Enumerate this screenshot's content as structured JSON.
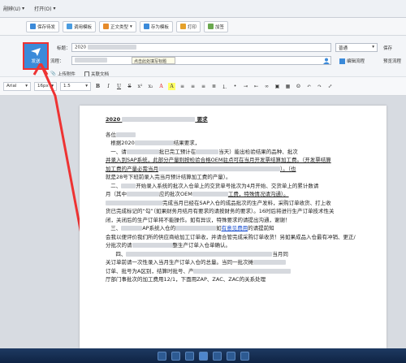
{
  "menubar": {
    "items": [
      "剐辨(U)",
      "打开(O)"
    ]
  },
  "toolbar": {
    "buttons": [
      {
        "label": "保存待发",
        "icon": "save-icon",
        "color": "#3b8ad9"
      },
      {
        "label": "调用模板",
        "icon": "template-icon",
        "color": "#4a9ce0"
      },
      {
        "label": "正文类型",
        "icon": "doc-type-icon",
        "color": "#e58a2a"
      },
      {
        "label": "存为模板",
        "icon": "save-template-icon",
        "color": "#3b8ad9"
      },
      {
        "label": "打印",
        "icon": "print-icon",
        "color": "#e5a12a"
      },
      {
        "label": "加签",
        "icon": "sign-icon",
        "color": "#6aa84f"
      }
    ]
  },
  "form": {
    "send_label": "发送",
    "title_label": "标题：",
    "title_value": "2020",
    "flow_label": "流程：",
    "tooltip": "点击此处填写标题",
    "priority": "普通",
    "save_label": "保存",
    "edit_flow": "编辑流程",
    "preview_flow": "预览流程",
    "attach_label": "上传附件",
    "related_doc": "关联文档"
  },
  "format": {
    "font": "Arial",
    "size": "16px",
    "line": "1.5"
  },
  "doc": {
    "title": "2020",
    "title_suffix": "要求",
    "l1": "各位",
    "l2a": "根据2020",
    "l2b": "结果要求，",
    "l3a": "一、请",
    "l3b": "批已完工预计在",
    "l3c": "当天）能出检验结果的品种、批次",
    "l4": "并录入到SAP系统，此部分产量则按检验合格OEM驻点可在当月开发票结算加工费。（开发票结算",
    "l5a": "加工费的产量必需当月",
    "l5b": "）。（也",
    "l6": "就是28号下班前录入完当月预计结算加工费的产量）。",
    "l7a": "二、",
    "l7b": "开始录入系统的批次入仓单上的交货单号批次为4月开始、交货单上的累计数请",
    "l8a": "月（其中",
    "l8b": "应的批次OEM",
    "l8c": "工费，特殊情况请沟通）。",
    "l9": "完成当月已经在SAP入仓的成品批次的生产发料，采购订单收货、打上收",
    "l10": "货已完成标记的“勾”（如果财务月结月有要求的请按财务的要求）。16时后将进行生产订单技术性关",
    "l11": "闭，关闭后的生产订单将不能操作。如有异议，特殊要求的请提出沟通，谢谢！",
    "l12a": "三、",
    "l12b": "AP系统入仓的",
    "l12c": "如",
    "l12d": "有意见费用",
    "l12e": "的请提前知",
    "l13": "会我以便评价我们所的供应商给加工订单收，并请合管完成采购订单收货！另如果成品入仓最有冲销、更正/",
    "l14a": "分批次的请",
    "l14b": "整生产订单入仓单确认。",
    "l15a": "四、",
    "l15b": "当月同",
    "l16": "关订单前请一次性录入当月生产订单入仓的总量。当同一批次摊",
    "l17a": "订单、批号为A区别，结算时批号、产",
    "l18": "厅部门事批次的加工费用12/1，下面用ZAP、ZAC、ZAC的关系处理"
  },
  "watermark": "软件技巧",
  "taskbar": {
    "icons": [
      "search-icon",
      "back-icon",
      "app-icon-1",
      "app-icon-2",
      "app-icon-3",
      "app-icon-4",
      "forward-icon"
    ]
  }
}
